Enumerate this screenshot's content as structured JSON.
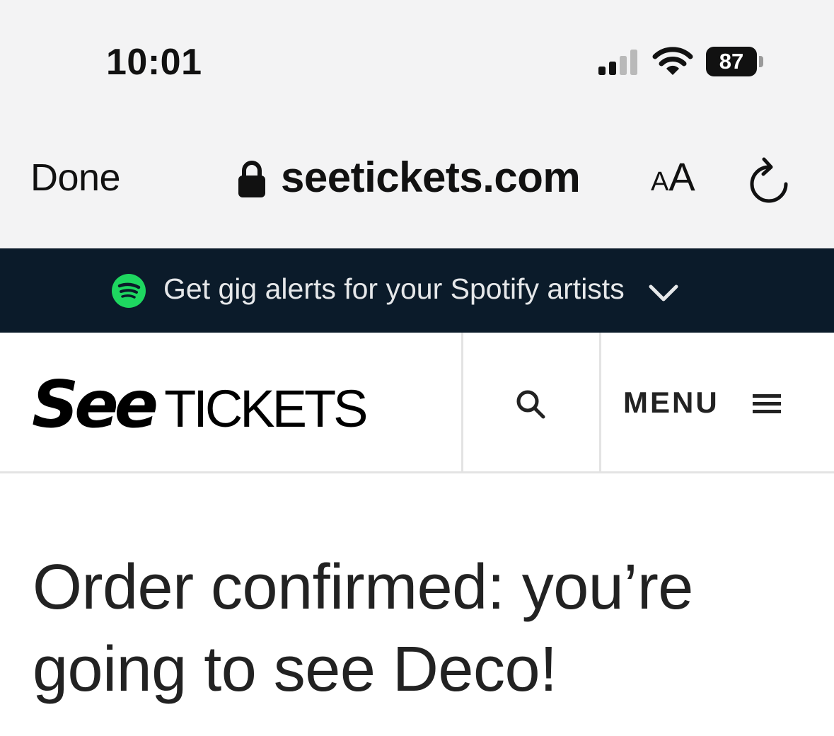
{
  "status_bar": {
    "time": "10:01",
    "battery_percent": "87"
  },
  "browser": {
    "done_label": "Done",
    "url": "seetickets.com",
    "text_size_small": "A",
    "text_size_large": "A"
  },
  "banner": {
    "text": "Get gig alerts for your Spotify artists",
    "icon": "spotify-icon",
    "brand_color": "#1ed760",
    "background_color": "#0b1b2a"
  },
  "header": {
    "logo_see": "See",
    "logo_tickets": "TICKETS",
    "menu_label": "MENU"
  },
  "content": {
    "title": "Order confirmed: you’re going to see Deco!"
  }
}
